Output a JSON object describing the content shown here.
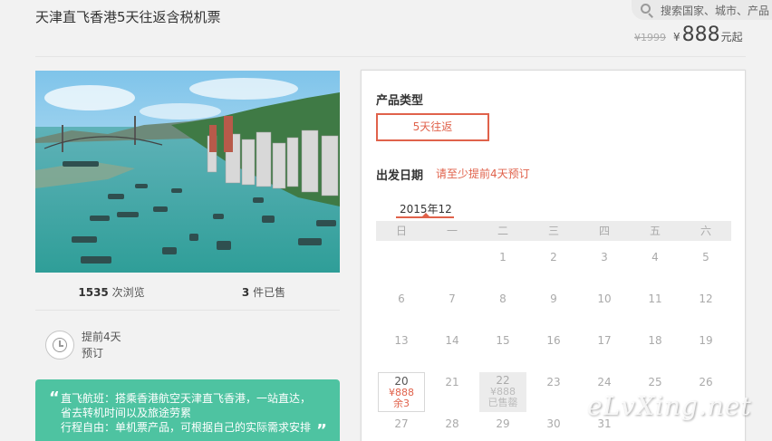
{
  "product": {
    "title": "天津直飞香港5天往返含税机票",
    "old_price": "¥1999",
    "currency": "¥",
    "price": "888",
    "price_suffix": "元起"
  },
  "search": {
    "placeholder": "搜索国家、城市、产品"
  },
  "stats": {
    "views_count": "1535",
    "views_label": " 次浏览",
    "sold_count": "3",
    "sold_label": " 件已售"
  },
  "advance": {
    "line1": "提前4天",
    "line2": "预订"
  },
  "feature": {
    "open_quote": "“",
    "close_quote": "”",
    "lines": [
      "直飞航班：搭乘香港航空天津直飞香港，一站直达，",
      "省去转机时间以及旅途劳累",
      "行程自由：单机票产品，可根据自己的实际需求安排"
    ]
  },
  "booking": {
    "type_label": "产品类型",
    "type_option": "5天往返",
    "date_label": "出发日期",
    "date_hint": "请至少提前4天预订",
    "month": "2015年12",
    "weekdays": [
      "日",
      "一",
      "二",
      "三",
      "四",
      "五",
      "六"
    ],
    "rows": [
      [
        "",
        "",
        "1",
        "2",
        "3",
        "4",
        "5"
      ],
      [
        "6",
        "7",
        "8",
        "9",
        "10",
        "11",
        "12"
      ],
      [
        "13",
        "14",
        "15",
        "16",
        "17",
        "18",
        "19"
      ],
      [
        "20",
        "21",
        "22",
        "23",
        "24",
        "25",
        "26"
      ],
      [
        "27",
        "28",
        "29",
        "30",
        "31",
        "",
        ""
      ]
    ],
    "selected_day": {
      "day": "20",
      "price": "¥888",
      "remaining": "余3"
    },
    "soldout_day": {
      "day": "22",
      "price": "¥888",
      "status": "已售罄"
    }
  },
  "watermark": "eLvXing.net",
  "colors": {
    "accent": "#e0624b",
    "feature_bg": "#4ec3a1"
  }
}
